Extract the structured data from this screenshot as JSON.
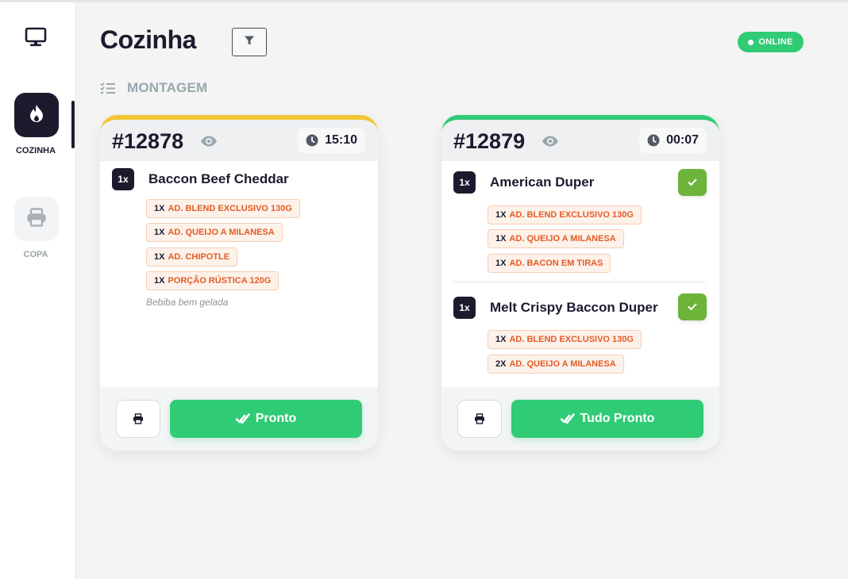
{
  "sidebar": {
    "icons": {
      "monitor": "monitor-icon",
      "kitchen": "flame-icon",
      "bar": "printer-icon"
    },
    "items": [
      {
        "label": "COZINHA",
        "active": true
      },
      {
        "label": "COPA",
        "active": false
      }
    ]
  },
  "header": {
    "title": "Cozinha",
    "filter_icon": "filter-icon",
    "status": "ONLINE"
  },
  "section": {
    "title": "MONTAGEM",
    "icon": "checklist-icon"
  },
  "colors": {
    "dark": "#1c1b2e",
    "green": "#2fcb75",
    "yellow": "#f4c534",
    "check_green": "#6cb43a",
    "addon_text": "#e45b27",
    "addon_bg": "#fdf2ea"
  },
  "orders": [
    {
      "number": "#12878",
      "time": "15:10",
      "accent": "#f4c534",
      "items": [
        {
          "qty": "1x",
          "name": "Baccon Beef Cheddar",
          "addons": [
            {
              "qty": "1X",
              "text": "AD. BLEND EXCLUSIVO 130G"
            },
            {
              "qty": "1X",
              "text": "AD. QUEIJO A MILANESA"
            },
            {
              "qty": "1X",
              "text": "AD. CHIPOTLE"
            },
            {
              "qty": "1X",
              "text": "PORÇÃO RÚSTICA 120G"
            }
          ],
          "note": "Bebiba bem gelada"
        }
      ],
      "action": "Pronto"
    },
    {
      "number": "#12879",
      "time": "00:07",
      "accent": "#2fcb75",
      "items": [
        {
          "qty": "1x",
          "name": "American Duper",
          "checked": true,
          "addons": [
            {
              "qty": "1X",
              "text": "AD. BLEND EXCLUSIVO 130G"
            },
            {
              "qty": "1X",
              "text": "AD. QUEIJO A MILANESA"
            },
            {
              "qty": "1X",
              "text": "AD. BACON EM TIRAS"
            }
          ]
        },
        {
          "qty": "1x",
          "name": "Melt Crispy Baccon Duper",
          "checked": true,
          "addons": [
            {
              "qty": "1X",
              "text": "AD. BLEND EXCLUSIVO 130G"
            },
            {
              "qty": "2X",
              "text": "AD. QUEIJO A MILANESA"
            }
          ]
        }
      ],
      "action": "Tudo Pronto"
    }
  ]
}
